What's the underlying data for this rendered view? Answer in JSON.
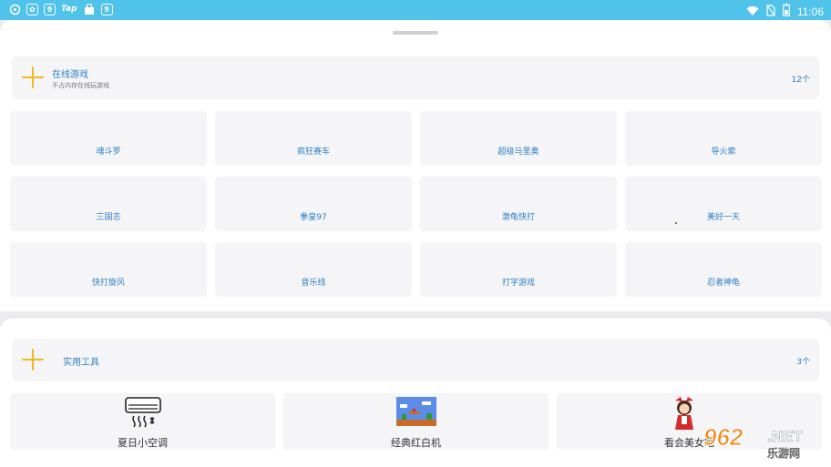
{
  "status_bar": {
    "tap_label": "Tap",
    "time": "11:06",
    "icons": [
      "pinwheel-icon",
      "baidu-icon",
      "app-9-icon",
      "taptap-icon",
      "bag-icon",
      "app-9-icon",
      "wifi-icon",
      "no-sim-icon",
      "battery-icon"
    ]
  },
  "online_games": {
    "title": "在线游戏",
    "subtitle": "不占内存在线玩游戏",
    "count": "12个",
    "games": [
      "魂斗罗",
      "疯狂赛车",
      "超级马里奥",
      "导火索",
      "三国志",
      "拳皇97",
      "激龟快打",
      "美好一天",
      "快打旋风",
      "音乐线",
      "打字游戏",
      "忍者神龟"
    ]
  },
  "tools": {
    "title": "实用工具",
    "count": "3个",
    "items": [
      {
        "label": "夏日小空调",
        "icon": "air-conditioner-icon"
      },
      {
        "label": "经典红白机",
        "icon": "retro-game-icon"
      },
      {
        "label": "看会美女吧",
        "icon": "anime-girl-icon"
      }
    ]
  },
  "watermark": {
    "number": "962",
    "suffix": ".NET",
    "cn": "乐游网"
  },
  "colors": {
    "status_bar": "#4fc3e9",
    "accent_plus": "#f3b723",
    "link_text": "#2b7fc4"
  }
}
